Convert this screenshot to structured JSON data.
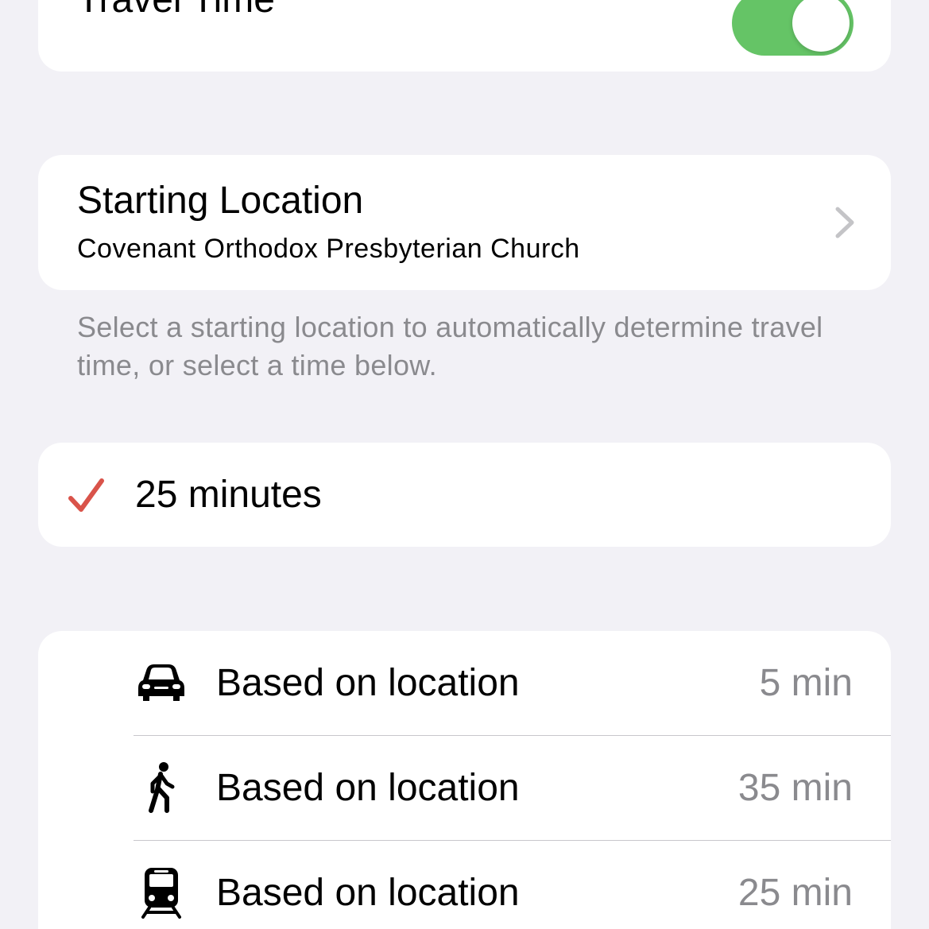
{
  "travel_time": {
    "title": "Travel Time",
    "toggle_on": true,
    "toggle_color": "#65c466"
  },
  "starting_location": {
    "title": "Starting Location",
    "value": "Covenant Orthodox Presbyterian Church",
    "chevron_icon": "chevron-right-icon"
  },
  "helper_text": "Select a starting location to automatically determine travel time, or select a time below.",
  "selected_time": {
    "label": "25 minutes",
    "check_icon": "checkmark-icon",
    "check_color": "#d9534a"
  },
  "modes": [
    {
      "icon": "car-icon",
      "label": "Based on location",
      "value": "5 min"
    },
    {
      "icon": "walking-icon",
      "label": "Based on location",
      "value": "35 min"
    },
    {
      "icon": "train-icon",
      "label": "Based on location",
      "value": "25 min"
    }
  ]
}
